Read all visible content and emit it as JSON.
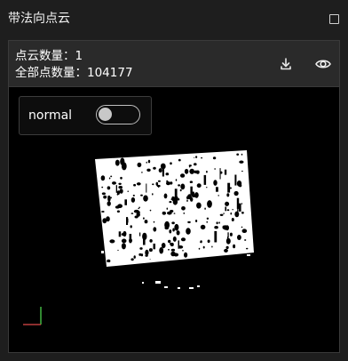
{
  "panel": {
    "title": "带法向点云"
  },
  "info": {
    "cloud_count_line": "点云数量：1",
    "total_points_line": "全部点数量：104177"
  },
  "toggle": {
    "label": "normal",
    "enabled": false
  },
  "icons": {
    "download": "download-icon",
    "visibility": "eye-icon",
    "checkbox": "checkbox-icon"
  }
}
